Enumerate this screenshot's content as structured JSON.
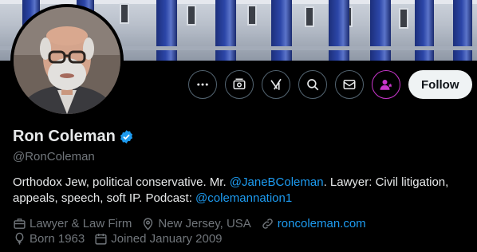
{
  "profile": {
    "name": "Ron Coleman",
    "handle": "@RonColeman",
    "verified": true,
    "bio": {
      "t1": "Orthodox Jew, political conservative. Mr. ",
      "mention1": "@JaneBColeman",
      "t2": ". Lawyer: Civil litigation, appeals, speech, soft IP. Podcast: ",
      "mention2": "@colemannation1"
    },
    "meta": {
      "category": "Lawyer & Law Firm",
      "location": "New Jersey, USA",
      "website": "roncoleman.com",
      "born": "Born 1963",
      "joined": "Joined January 2009"
    }
  },
  "actions": {
    "follow_label": "Follow",
    "icons": [
      "more-icon",
      "money-icon",
      "grok-icon",
      "search-icon",
      "mail-icon",
      "subscribe-icon"
    ]
  },
  "colors": {
    "accent": "#1d9bf0",
    "muted": "#71767b",
    "background": "#000000",
    "subscribe": "#c936cc"
  }
}
